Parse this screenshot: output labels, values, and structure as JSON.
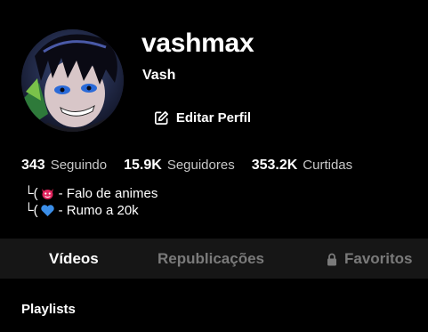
{
  "profile": {
    "username": "vashmax",
    "display_name": "Vash",
    "edit_button_label": "Editar Perfil"
  },
  "stats": [
    {
      "value": "343",
      "label": "Seguindo"
    },
    {
      "value": "15.9K",
      "label": "Seguidores"
    },
    {
      "value": "353.2K",
      "label": "Curtidas"
    }
  ],
  "bio": {
    "lines": [
      {
        "prefix": "└(",
        "emoji": "red-devil-emoji",
        "text": "- Falo de animes"
      },
      {
        "prefix": "└(",
        "emoji": "blue-heart-emoji",
        "text": "- Rumo a 20k"
      }
    ]
  },
  "tabs": [
    {
      "label": "Vídeos",
      "active": true
    },
    {
      "label": "Republicações",
      "active": false
    },
    {
      "label": "Favoritos",
      "active": false,
      "icon": "lock-icon"
    }
  ],
  "sections": {
    "playlists_title": "Playlists"
  },
  "colors": {
    "background": "#000000",
    "tab_bar": "#161616",
    "inactive_tab": "#7a7a7a",
    "muted_label": "#c8c8c8",
    "heart_blue": "#3b8ee8",
    "devil_red": "#e0245e"
  }
}
